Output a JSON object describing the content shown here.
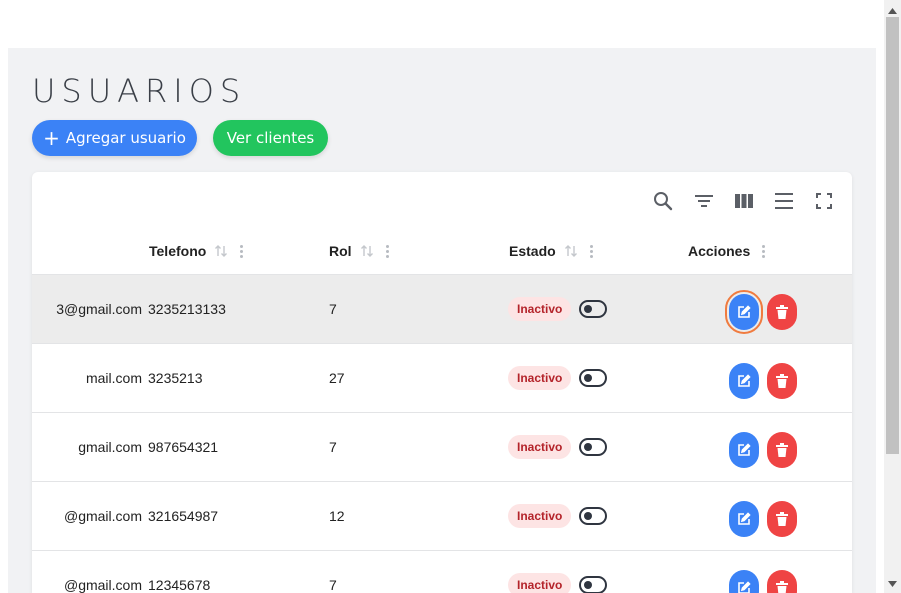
{
  "page": {
    "title": "USUARIOS",
    "add_button": "Agregar usuario",
    "add_icon": "+",
    "clients_button": "Ver clientes"
  },
  "toolbar": {
    "icons": [
      "search-icon",
      "filter-icon",
      "columns-icon",
      "density-icon",
      "fullscreen-icon"
    ]
  },
  "table": {
    "columns": {
      "telefono": "Telefono",
      "rol": "Rol",
      "estado": "Estado",
      "acciones": "Acciones"
    },
    "rows": [
      {
        "email": "3@gmail.com",
        "telefono": "3235213133",
        "rol": "7",
        "estado": "Inactivo"
      },
      {
        "email": "mail.com",
        "telefono": "3235213",
        "rol": "27",
        "estado": "Inactivo"
      },
      {
        "email": "gmail.com",
        "telefono": "987654321",
        "rol": "7",
        "estado": "Inactivo"
      },
      {
        "email": "@gmail.com",
        "telefono": "321654987",
        "rol": "12",
        "estado": "Inactivo"
      },
      {
        "email": "@gmail.com",
        "telefono": "12345678",
        "rol": "7",
        "estado": "Inactivo"
      }
    ]
  },
  "colors": {
    "primary": "#3b82f6",
    "success": "#22c55e",
    "danger": "#ef4444",
    "inactive_bg": "#fde4e4",
    "inactive_text": "#b4232a",
    "focus_ring": "#f07b3f"
  }
}
